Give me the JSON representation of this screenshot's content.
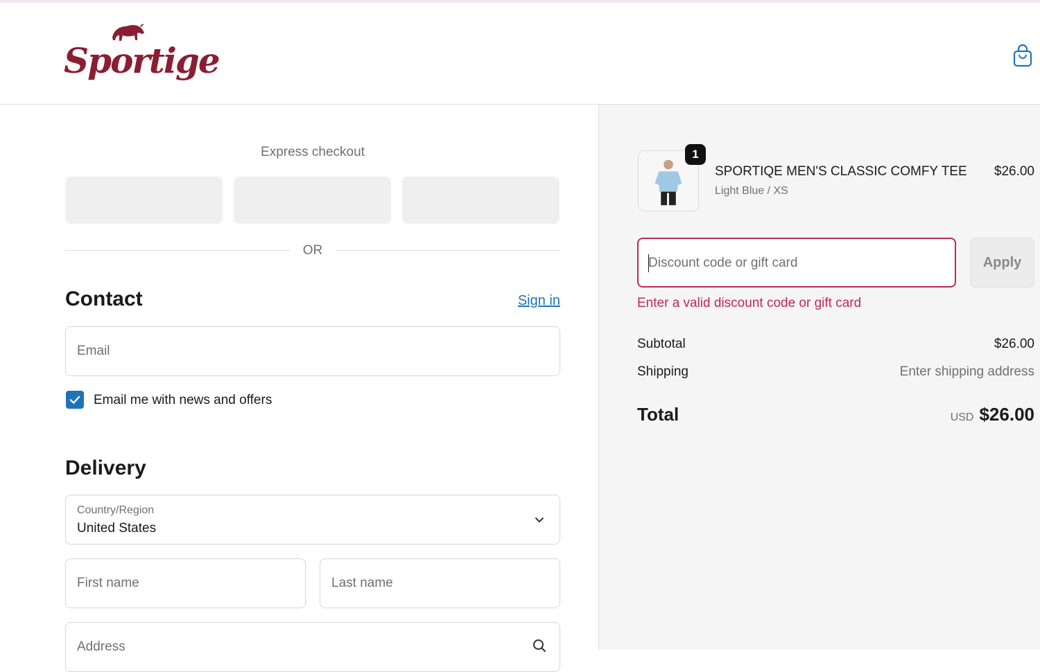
{
  "brand": {
    "name": "Sportige",
    "accent": "#8a1e33"
  },
  "header": {
    "cart_icon": "shopping-bag-icon"
  },
  "express_checkout": {
    "title": "Express checkout",
    "or_label": "OR"
  },
  "contact": {
    "title": "Contact",
    "sign_in_label": "Sign in",
    "email_placeholder": "Email",
    "newsletter_label": "Email me with news and offers",
    "newsletter_checked": true
  },
  "delivery": {
    "title": "Delivery",
    "country_label": "Country/Region",
    "country_value": "United States",
    "first_name_placeholder": "First name",
    "last_name_placeholder": "Last name",
    "address_placeholder": "Address"
  },
  "order": {
    "item": {
      "name": "SPORTIQE MEN'S CLASSIC COMFY TEE",
      "variant": "Light Blue / XS",
      "price": "$26.00",
      "quantity": "1"
    },
    "discount_placeholder": "Discount code or gift card",
    "apply_label": "Apply",
    "error": "Enter a valid discount code or gift card",
    "subtotal_label": "Subtotal",
    "subtotal_value": "$26.00",
    "shipping_label": "Shipping",
    "shipping_value": "Enter shipping address",
    "total_label": "Total",
    "currency": "USD",
    "total_value": "$26.00"
  },
  "colors": {
    "link": "#1f74b8",
    "error": "#c0275a",
    "muted": "#707070"
  }
}
